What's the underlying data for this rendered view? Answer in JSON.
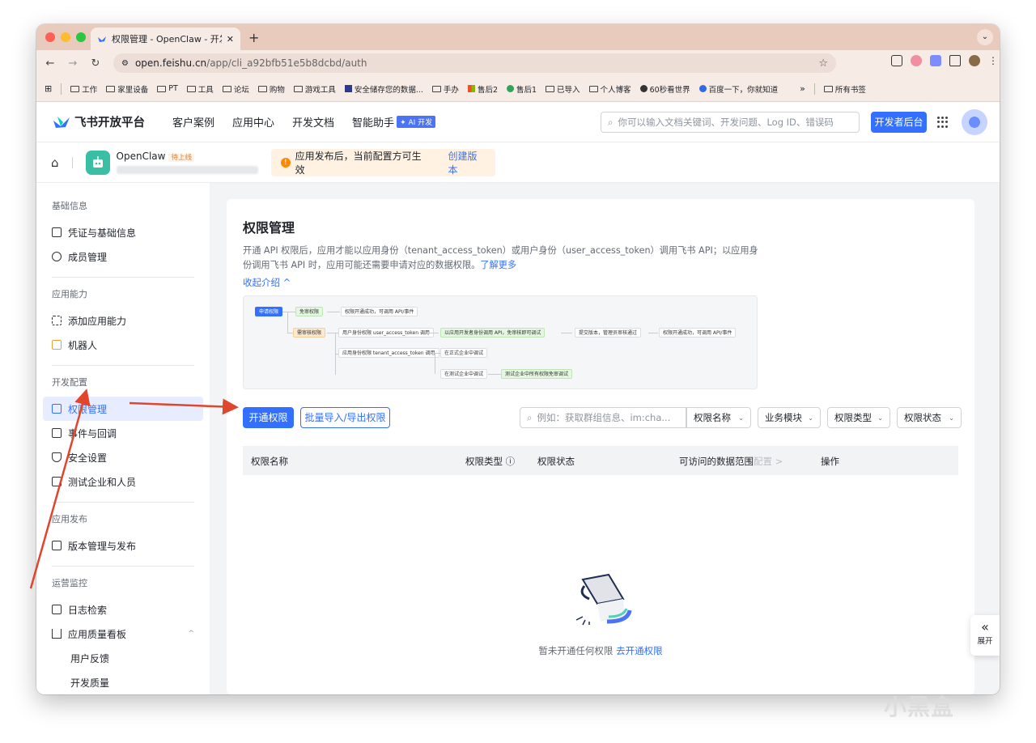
{
  "browser": {
    "tab_title": "权限管理 - OpenClaw - 开发者",
    "url_host": "open.feishu.cn",
    "url_path": "/app/cli_a92bfb51e5b8dcbd/auth",
    "bookmarks": [
      "工作",
      "家里设备",
      "PT",
      "工具",
      "论坛",
      "购物",
      "游戏工具",
      "安全储存您的数据...",
      "手办",
      "售后2",
      "售后1",
      "已导入",
      "个人博客",
      "60秒看世界",
      "百度一下，你就知道"
    ],
    "more": "»",
    "all_bookmarks": "所有书签"
  },
  "header": {
    "logo": "飞书开放平台",
    "nav": [
      "客户案例",
      "应用中心",
      "开发文档",
      "智能助手"
    ],
    "ai_badge": "✦ AI 开发",
    "search_placeholder": "你可以输入文档关键词、开发问题、Log ID、错误码",
    "dev_button": "开发者后台"
  },
  "appbar": {
    "app_name": "OpenClaw",
    "status": "待上线",
    "notice": "应用发布后，当前配置方可生效",
    "notice_link": "创建版本"
  },
  "sidebar": {
    "g1": "基础信息",
    "i_cred": "凭证与基础信息",
    "i_member": "成员管理",
    "g2": "应用能力",
    "i_addcap": "添加应用能力",
    "i_bot": "机器人",
    "g3": "开发配置",
    "i_perm": "权限管理",
    "i_event": "事件与回调",
    "i_security": "安全设置",
    "i_test": "测试企业和人员",
    "g4": "应用发布",
    "i_version": "版本管理与发布",
    "g5": "运营监控",
    "i_log": "日志检索",
    "i_quality": "应用质量看板",
    "i_feedback": "用户反馈",
    "i_devquality": "开发质量"
  },
  "page": {
    "title": "权限管理",
    "desc": "开通 API 权限后，应用才能以应用身份（tenant_access_token）或用户身份（user_access_token）调用飞书 API；以应用身份调用飞书 API 时，应用可能还需要申请对应的数据权限。",
    "learn_more": "了解更多",
    "collapse": "收起介绍 ^",
    "flow": {
      "apply": "申请权限",
      "no_review": "免审权限",
      "ok1": "权限开通成功，可调用 API/事件",
      "need_review": "需审核权限",
      "user_perm": "用户身份权限 user_access_token 调用",
      "user_call": "以应用开发者身份调用 API，免审核即可调试",
      "submit": "提交版本，管理员审核通过",
      "ok2": "权限开通成功，可调用 API/事件",
      "app_perm": "应用身份权限 tenant_access_token 调用",
      "formal": "在正式企业中调试",
      "test": "在测试企业中调试",
      "test_ok": "测试企业中所有权限免审调试"
    },
    "btn_open": "开通权限",
    "btn_batch": "批量导入/导出权限",
    "search_placeholder": "例如：获取群组信息、im:cha...",
    "sel_name": "权限名称",
    "sel_module": "业务模块",
    "sel_type": "权限类型",
    "sel_status": "权限状态",
    "col_name": "权限名称",
    "col_type": "权限类型 ⓘ",
    "col_status": "权限状态",
    "col_range": "可访问的数据范围",
    "col_range_cfg": "配置 >",
    "col_action": "操作",
    "empty_text": "暂未开通任何权限",
    "empty_link": "去开通权限",
    "expand": "展开"
  },
  "watermark": "小黑盒",
  "colors": {
    "accent": "#3370ff",
    "arrow": "#e0452d",
    "titlebar": "#e9cbbd"
  }
}
